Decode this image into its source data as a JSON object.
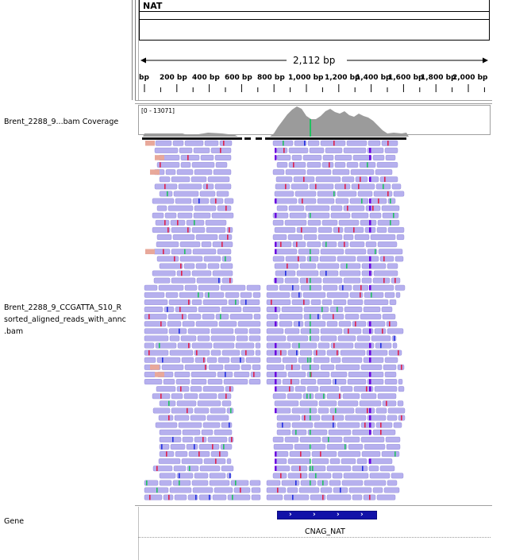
{
  "locus": {
    "name": "NAT"
  },
  "ruler": {
    "span_label": "2,112 bp",
    "ticks": [
      "bp",
      "200 bp",
      "400 bp",
      "600 bp",
      "800 bp",
      "1,000 bp",
      "1,200 bp",
      "1,400 bp",
      "1,600 bp",
      "1,800 bp",
      "2,000 bp"
    ]
  },
  "tracks": {
    "coverage_name": "Brent_2288_9...bam Coverage",
    "coverage_range": "[0 - 13071]",
    "alignment_name_lines": [
      "Brent_2288_9_CCGATTA_S10_R",
      "sorted_aligned_reads_with_annc",
      ".bam"
    ],
    "gene_track_name": "Gene"
  },
  "gene": {
    "name": "CNAG_NAT",
    "strand_glyph": "›",
    "color": "#1212a8"
  },
  "colors": {
    "coverage": "#9b9b9b",
    "read_fill": "#b6b0ee",
    "read_dot": "#8b84d6",
    "soft_clip": "#e8a89a",
    "mismatch_red": "#e0204a",
    "mismatch_green": "#20c060",
    "mismatch_blue": "#2030e0",
    "insertion": "#6a00e0"
  }
}
